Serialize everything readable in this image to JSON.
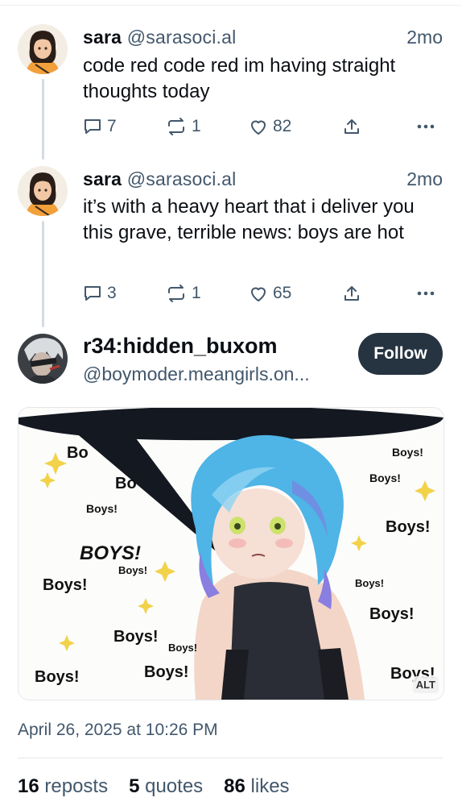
{
  "posts": [
    {
      "author_name": "sara",
      "author_handle": "@sarasoci.al",
      "time": "2mo",
      "text": "code red code red im having straight thoughts today",
      "replies": "7",
      "reposts": "1",
      "likes": "82"
    },
    {
      "author_name": "sara",
      "author_handle": "@sarasoci.al",
      "time": "2mo",
      "text": "it’s with a heavy heart that i deliver you this grave, terrible news: boys are hot",
      "replies": "3",
      "reposts": "1",
      "likes": "65"
    }
  ],
  "main_post": {
    "author_name": "r34:hidden_buxom",
    "author_handle": "@boymoder.meangirls.on...",
    "follow_label": "Follow",
    "image_alt_badge": "ALT",
    "image_words": {
      "boys": "Boys!",
      "boys_caps": "BOYS!",
      "partial_1": "Bo",
      "partial_2": "Bo"
    },
    "date": "April 26, 2025 at 10:26 PM",
    "stats": {
      "reposts_count": "16",
      "reposts_label": "reposts",
      "quotes_count": "5",
      "quotes_label": "quotes",
      "likes_count": "86",
      "likes_label": "likes"
    }
  },
  "icons": [
    "reply-icon",
    "repost-icon",
    "like-icon",
    "share-icon",
    "more-icon"
  ],
  "colors": {
    "text_primary": "#0b0f14",
    "text_secondary": "#42576c",
    "follow_button_bg": "#263340",
    "thread_line": "#d5dbe1"
  }
}
